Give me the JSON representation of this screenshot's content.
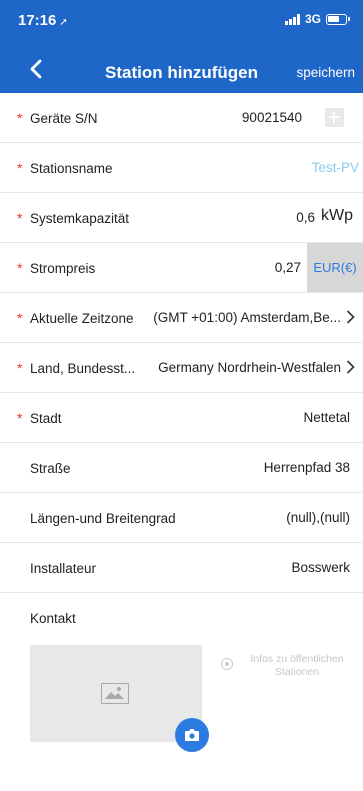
{
  "status_bar": {
    "time": "17:16",
    "network": "3G"
  },
  "nav": {
    "title": "Station hinzufügen",
    "save_label": "speichern"
  },
  "fields": [
    {
      "label": "Geräte S/N",
      "value": "90021540",
      "required": true
    },
    {
      "label": "Stationsname",
      "value": "",
      "placeholder": "Test-PV",
      "required": true
    },
    {
      "label": "Systemkapazität",
      "value": "0,6",
      "unit": "kWp",
      "required": true
    },
    {
      "label": "Strompreis",
      "value": "0,27",
      "currency": "EUR(€)",
      "required": true
    },
    {
      "label": "Aktuelle Zeitzone",
      "value": "(GMT +01:00) Amsterdam,Be...",
      "required": true
    },
    {
      "label": "Land, Bundesst...",
      "value": "Germany Nordrhein-Westfalen",
      "required": true
    },
    {
      "label": "Stadt",
      "value": "Nettetal",
      "required": true
    },
    {
      "label": "Straße",
      "value": "Herrenpfad 38",
      "required": false
    },
    {
      "label": "Längen-und Breitengrad",
      "value": "(null),(null)",
      "required": false
    },
    {
      "label": "Installateur",
      "value": "Bosswerk",
      "required": false
    },
    {
      "label": "Kontakt",
      "value": "",
      "required": false
    }
  ],
  "public_station": {
    "label": "Infos zu öffentlichen Stationen",
    "selected": false
  },
  "icons": {
    "back": "chevron-left-icon",
    "add": "plus-icon",
    "chevron": "chevron-right-icon",
    "image": "image-placeholder-icon",
    "camera": "camera-icon",
    "location": "location-arrow-icon"
  },
  "colors": {
    "header": "#1e66c8",
    "required": "#e8352f",
    "accent": "#2d7be0",
    "placeholder": "#8ec8ef"
  }
}
